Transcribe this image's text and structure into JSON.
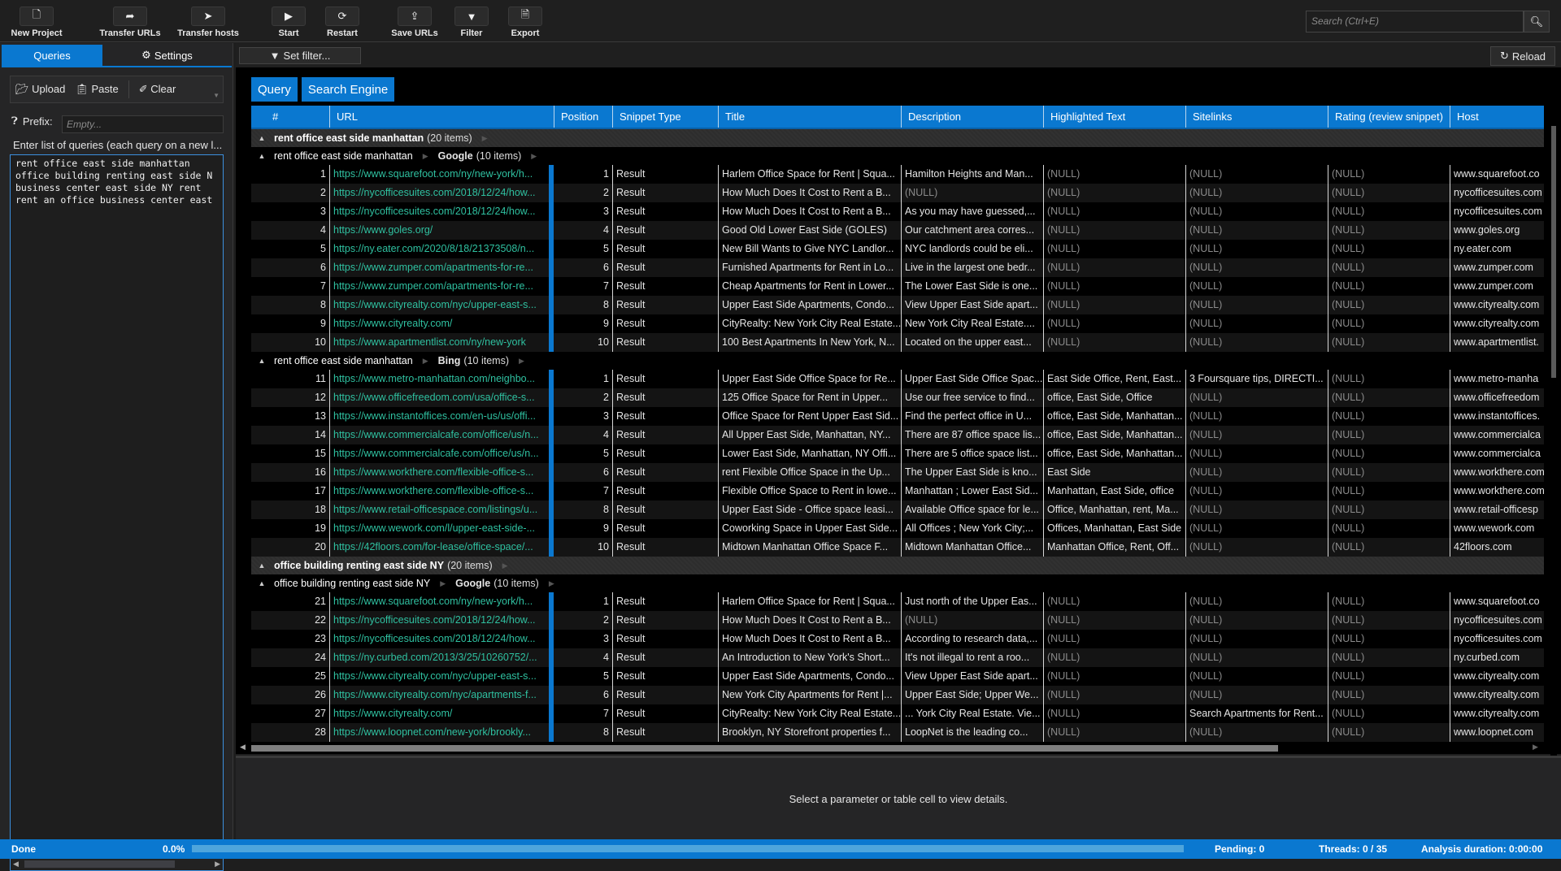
{
  "toolbar": {
    "buttons": [
      {
        "label": "New Project",
        "icon": "new-file-icon"
      },
      {
        "label": "Transfer URLs",
        "icon": "share-arrow-icon"
      },
      {
        "label": "Transfer hosts",
        "icon": "location-arrow-icon"
      },
      {
        "label": "Start",
        "icon": "play-icon"
      },
      {
        "label": "Restart",
        "icon": "refresh-icon"
      },
      {
        "label": "Save URLs",
        "icon": "upload-icon"
      },
      {
        "label": "Filter",
        "icon": "filter-icon"
      },
      {
        "label": "Export",
        "icon": "excel-file-icon"
      }
    ],
    "search_placeholder": "Search (Ctrl+E)"
  },
  "left_panel": {
    "tabs": [
      {
        "label": "Queries",
        "active": true
      },
      {
        "label": "Settings",
        "active": false
      }
    ],
    "actions": {
      "upload": "Upload",
      "paste": "Paste",
      "clear": "Clear"
    },
    "prefix_label": "Prefix:",
    "prefix_placeholder": "Empty...",
    "hint": "Enter list of queries (each query on a new l...",
    "queries_text": "rent office east side manhattan\noffice building renting east side N\nbusiness center east side NY rent\nrent an office business center east"
  },
  "main": {
    "set_filter": "Set filter...",
    "reload": "Reload",
    "group_chips": [
      "Query",
      "Search Engine"
    ],
    "columns": [
      "#",
      "URL",
      "Position",
      "Snippet Type",
      "Title",
      "Description",
      "Highlighted Text",
      "Sitelinks",
      "Rating (review snippet)",
      "Host"
    ],
    "groups": [
      {
        "query": "rent office east side manhattan",
        "count": "(20 items)",
        "engines": [
          {
            "engine": "Google",
            "count": "(10 items)",
            "rows": [
              {
                "n": "1",
                "url": "https://www.squarefoot.com/ny/new-york/h...",
                "pos": "1",
                "type": "Result",
                "title": "Harlem Office Space for Rent | Squa...",
                "desc": "Hamilton Heights and Man...",
                "hl": "(NULL)",
                "sl": "(NULL)",
                "rating": "(NULL)",
                "host": "www.squarefoot.co"
              },
              {
                "n": "2",
                "url": "https://nycofficesuites.com/2018/12/24/how...",
                "pos": "2",
                "type": "Result",
                "title": "How Much Does It Cost to Rent a B...",
                "desc": "(NULL)",
                "hl": "(NULL)",
                "sl": "(NULL)",
                "rating": "(NULL)",
                "host": "nycofficesuites.com"
              },
              {
                "n": "3",
                "url": "https://nycofficesuites.com/2018/12/24/how...",
                "pos": "3",
                "type": "Result",
                "title": "How Much Does It Cost to Rent a B...",
                "desc": "As you may have guessed,...",
                "hl": "(NULL)",
                "sl": "(NULL)",
                "rating": "(NULL)",
                "host": "nycofficesuites.com"
              },
              {
                "n": "4",
                "url": "https://www.goles.org/",
                "pos": "4",
                "type": "Result",
                "title": "Good Old Lower East Side (GOLES)",
                "desc": "Our catchment area corres...",
                "hl": "(NULL)",
                "sl": "(NULL)",
                "rating": "(NULL)",
                "host": "www.goles.org"
              },
              {
                "n": "5",
                "url": "https://ny.eater.com/2020/8/18/21373508/n...",
                "pos": "5",
                "type": "Result",
                "title": "New Bill Wants to Give NYC Landlor...",
                "desc": "NYC landlords could be eli...",
                "hl": "(NULL)",
                "sl": "(NULL)",
                "rating": "(NULL)",
                "host": "ny.eater.com"
              },
              {
                "n": "6",
                "url": "https://www.zumper.com/apartments-for-re...",
                "pos": "6",
                "type": "Result",
                "title": "Furnished Apartments for Rent in Lo...",
                "desc": "Live in the largest one bedr...",
                "hl": "(NULL)",
                "sl": "(NULL)",
                "rating": "(NULL)",
                "host": "www.zumper.com"
              },
              {
                "n": "7",
                "url": "https://www.zumper.com/apartments-for-re...",
                "pos": "7",
                "type": "Result",
                "title": "Cheap Apartments for Rent in Lower...",
                "desc": "The Lower East Side is one...",
                "hl": "(NULL)",
                "sl": "(NULL)",
                "rating": "(NULL)",
                "host": "www.zumper.com"
              },
              {
                "n": "8",
                "url": "https://www.cityrealty.com/nyc/upper-east-s...",
                "pos": "8",
                "type": "Result",
                "title": "Upper East Side Apartments, Condo...",
                "desc": "View Upper East Side apart...",
                "hl": "(NULL)",
                "sl": "(NULL)",
                "rating": "(NULL)",
                "host": "www.cityrealty.com"
              },
              {
                "n": "9",
                "url": "https://www.cityrealty.com/",
                "pos": "9",
                "type": "Result",
                "title": "CityRealty: New York City Real Estate...",
                "desc": "New York City Real Estate....",
                "hl": "(NULL)",
                "sl": "(NULL)",
                "rating": "(NULL)",
                "host": "www.cityrealty.com"
              },
              {
                "n": "10",
                "url": "https://www.apartmentlist.com/ny/new-york",
                "pos": "10",
                "type": "Result",
                "title": "100 Best Apartments In New York, N...",
                "desc": "Located on the upper east...",
                "hl": "(NULL)",
                "sl": "(NULL)",
                "rating": "(NULL)",
                "host": "www.apartmentlist."
              }
            ]
          },
          {
            "engine": "Bing",
            "count": "(10 items)",
            "rows": [
              {
                "n": "11",
                "url": "https://www.metro-manhattan.com/neighbo...",
                "pos": "1",
                "type": "Result",
                "title": "Upper East Side Office Space for Re...",
                "desc": "Upper East Side Office Spac...",
                "hl": "East Side Office, Rent, East...",
                "sl": "3 Foursquare tips, DIRECTI...",
                "rating": "(NULL)",
                "host": "www.metro-manha"
              },
              {
                "n": "12",
                "url": "https://www.officefreedom.com/usa/office-s...",
                "pos": "2",
                "type": "Result",
                "title": "125 Office Space for Rent in Upper...",
                "desc": "Use our free service to find...",
                "hl": "office, East Side, Office",
                "sl": "(NULL)",
                "rating": "(NULL)",
                "host": "www.officefreedom"
              },
              {
                "n": "13",
                "url": "https://www.instantoffices.com/en-us/us/offi...",
                "pos": "3",
                "type": "Result",
                "title": "Office Space for Rent Upper East Sid...",
                "desc": "Find the perfect office in U...",
                "hl": "office, East Side, Manhattan...",
                "sl": "(NULL)",
                "rating": "(NULL)",
                "host": "www.instantoffices."
              },
              {
                "n": "14",
                "url": "https://www.commercialcafe.com/office/us/n...",
                "pos": "4",
                "type": "Result",
                "title": "All Upper East Side, Manhattan, NY...",
                "desc": "There are 87 office space lis...",
                "hl": "office, East Side, Manhattan...",
                "sl": "(NULL)",
                "rating": "(NULL)",
                "host": "www.commercialca"
              },
              {
                "n": "15",
                "url": "https://www.commercialcafe.com/office/us/n...",
                "pos": "5",
                "type": "Result",
                "title": "Lower East Side, Manhattan, NY Offi...",
                "desc": "There are 5 office space list...",
                "hl": "office, East Side, Manhattan...",
                "sl": "(NULL)",
                "rating": "(NULL)",
                "host": "www.commercialca"
              },
              {
                "n": "16",
                "url": "https://www.workthere.com/flexible-office-s...",
                "pos": "6",
                "type": "Result",
                "title": "rent Flexible Office Space in the Up...",
                "desc": "The Upper East Side is kno...",
                "hl": "East Side",
                "sl": "(NULL)",
                "rating": "(NULL)",
                "host": "www.workthere.com"
              },
              {
                "n": "17",
                "url": "https://www.workthere.com/flexible-office-s...",
                "pos": "7",
                "type": "Result",
                "title": "Flexible Office Space to Rent in lowe...",
                "desc": "Manhattan ; Lower East Sid...",
                "hl": "Manhattan, East Side, office",
                "sl": "(NULL)",
                "rating": "(NULL)",
                "host": "www.workthere.com"
              },
              {
                "n": "18",
                "url": "https://www.retail-officespace.com/listings/u...",
                "pos": "8",
                "type": "Result",
                "title": "Upper East Side - Office space leasi...",
                "desc": "Available Office space for le...",
                "hl": "Office, Manhattan, rent, Ma...",
                "sl": "(NULL)",
                "rating": "(NULL)",
                "host": "www.retail-officesp"
              },
              {
                "n": "19",
                "url": "https://www.wework.com/l/upper-east-side-...",
                "pos": "9",
                "type": "Result",
                "title": "Coworking Space in Upper East Side...",
                "desc": "All Offices ; New York City;...",
                "hl": "Offices, Manhattan, East Side",
                "sl": "(NULL)",
                "rating": "(NULL)",
                "host": "www.wework.com"
              },
              {
                "n": "20",
                "url": "https://42floors.com/for-lease/office-space/...",
                "pos": "10",
                "type": "Result",
                "title": "Midtown Manhattan Office Space F...",
                "desc": "Midtown Manhattan Office...",
                "hl": "Manhattan Office, Rent, Off...",
                "sl": "(NULL)",
                "rating": "(NULL)",
                "host": "42floors.com"
              }
            ]
          }
        ]
      },
      {
        "query": "office building renting east side NY",
        "count": "(20 items)",
        "engines": [
          {
            "engine": "Google",
            "count": "(10 items)",
            "rows": [
              {
                "n": "21",
                "url": "https://www.squarefoot.com/ny/new-york/h...",
                "pos": "1",
                "type": "Result",
                "title": "Harlem Office Space for Rent | Squa...",
                "desc": "Just north of the Upper Eas...",
                "hl": "(NULL)",
                "sl": "(NULL)",
                "rating": "(NULL)",
                "host": "www.squarefoot.co"
              },
              {
                "n": "22",
                "url": "https://nycofficesuites.com/2018/12/24/how...",
                "pos": "2",
                "type": "Result",
                "title": "How Much Does It Cost to Rent a B...",
                "desc": "(NULL)",
                "hl": "(NULL)",
                "sl": "(NULL)",
                "rating": "(NULL)",
                "host": "nycofficesuites.com"
              },
              {
                "n": "23",
                "url": "https://nycofficesuites.com/2018/12/24/how...",
                "pos": "3",
                "type": "Result",
                "title": "How Much Does It Cost to Rent a B...",
                "desc": "According to research data,...",
                "hl": "(NULL)",
                "sl": "(NULL)",
                "rating": "(NULL)",
                "host": "nycofficesuites.com"
              },
              {
                "n": "24",
                "url": "https://ny.curbed.com/2013/3/25/10260752/...",
                "pos": "4",
                "type": "Result",
                "title": "An Introduction to New York's Short...",
                "desc": "It's not illegal to rent a roo...",
                "hl": "(NULL)",
                "sl": "(NULL)",
                "rating": "(NULL)",
                "host": "ny.curbed.com"
              },
              {
                "n": "25",
                "url": "https://www.cityrealty.com/nyc/upper-east-s...",
                "pos": "5",
                "type": "Result",
                "title": "Upper East Side Apartments, Condo...",
                "desc": "View Upper East Side apart...",
                "hl": "(NULL)",
                "sl": "(NULL)",
                "rating": "(NULL)",
                "host": "www.cityrealty.com"
              },
              {
                "n": "26",
                "url": "https://www.cityrealty.com/nyc/apartments-f...",
                "pos": "6",
                "type": "Result",
                "title": "New York City Apartments for Rent |...",
                "desc": "Upper East Side; Upper We...",
                "hl": "(NULL)",
                "sl": "(NULL)",
                "rating": "(NULL)",
                "host": "www.cityrealty.com"
              },
              {
                "n": "27",
                "url": "https://www.cityrealty.com/",
                "pos": "7",
                "type": "Result",
                "title": "CityRealty: New York City Real Estate...",
                "desc": "... York City Real Estate. Vie...",
                "hl": "(NULL)",
                "sl": "Search Apartments for Rent...",
                "rating": "(NULL)",
                "host": "www.cityrealty.com"
              },
              {
                "n": "28",
                "url": "https://www.loopnet.com/new-york/brookly...",
                "pos": "8",
                "type": "Result",
                "title": "Brooklyn, NY Storefront properties f...",
                "desc": "LoopNet is the leading co...",
                "hl": "(NULL)",
                "sl": "(NULL)",
                "rating": "(NULL)",
                "host": "www.loopnet.com"
              }
            ]
          }
        ]
      }
    ]
  },
  "detail_panel": {
    "message": "Select a parameter or table cell to view details."
  },
  "status_bar": {
    "state": "Done",
    "progress_text": "0.0%",
    "progress_fraction": 0.0,
    "pending": "Pending: 0",
    "threads": "Threads: 0 / 35",
    "duration": "Analysis duration: 0:00:00"
  },
  "colors": {
    "accent": "#0a78d0",
    "url": "#2fc0a0",
    "null": "#8b8b8b"
  }
}
